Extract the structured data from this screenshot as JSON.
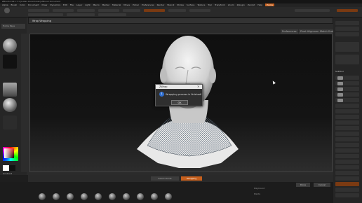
{
  "window": {
    "title": "ZBrush 2021.7.1 [Lukas Ourednicek] ZBrush Document"
  },
  "menubar": {
    "items": [
      "Alpha",
      "Brush",
      "Color",
      "Document",
      "Draw",
      "Dynamics",
      "Edit",
      "File",
      "Layer",
      "Light",
      "Macro",
      "Marker",
      "Material",
      "Movie",
      "Picker",
      "Preferences",
      "Render",
      "Stencil",
      "Stroke",
      "Surface",
      "Texture",
      "Tool",
      "Transform",
      "Zoom",
      "Zplugin",
      "Zscript",
      "Help"
    ],
    "highlighted": "Home"
  },
  "dialog_window": {
    "title": "Wrap Wrapping",
    "preferences": "Preferences",
    "pivot_alignment": "Pivot Alignment",
    "match_scale": "Match Scale",
    "select_points": "Select Points",
    "wrapping": "Wrapping",
    "done": "Done",
    "cancel": "Cancel"
  },
  "left_panel": {
    "header": "Home Page",
    "subtool_label": "Gradient"
  },
  "popup": {
    "title": "ZWrap",
    "close": "×",
    "icon": "info-icon",
    "message": "Wrapping process is finished!",
    "ok": "OK"
  },
  "right_panel": {
    "subtool_title": "SubTool"
  },
  "status": {
    "poly_label": "PolyCount",
    "point_label": "Points"
  },
  "colors": {
    "accent": "#c7601d",
    "info": "#2f6fd1"
  }
}
